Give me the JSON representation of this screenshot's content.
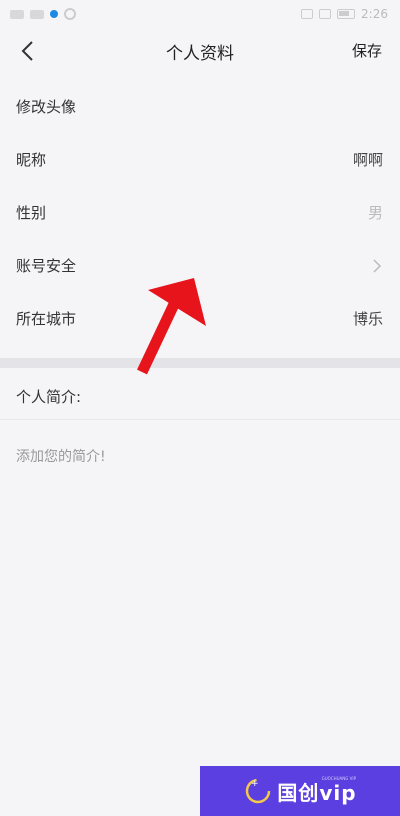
{
  "status_bar": {
    "time": "2:26"
  },
  "header": {
    "title": "个人资料",
    "save_label": "保存"
  },
  "rows": [
    {
      "label": "修改头像",
      "value": ""
    },
    {
      "label": "昵称",
      "value": "啊啊"
    },
    {
      "label": "性别",
      "value": "男"
    },
    {
      "label": "账号安全",
      "value": ""
    },
    {
      "label": "所在城市",
      "value": "博乐"
    }
  ],
  "intro": {
    "title": "个人简介:",
    "placeholder": "添加您的简介!"
  },
  "annotation": {
    "arrow_color": "#e8141c"
  },
  "watermark": {
    "text": "国创vip",
    "sub": "GUOCHUANG VIP",
    "bg_color": "#5b3fe0"
  }
}
